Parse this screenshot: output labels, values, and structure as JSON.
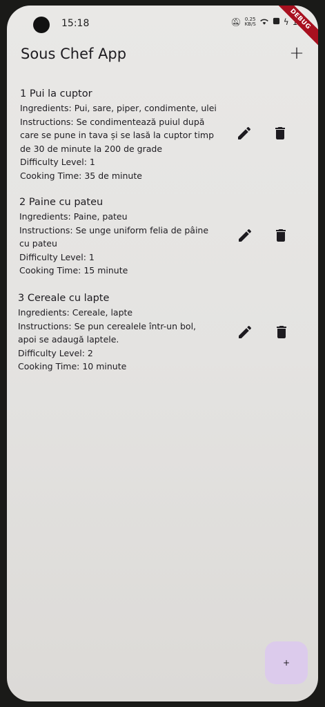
{
  "status_bar": {
    "time": "15:18",
    "net_speed": "0.25\nKB/S",
    "battery": "14",
    "debug_label": "DEBUG"
  },
  "app_bar": {
    "title": "Sous Chef App",
    "add_label": "+"
  },
  "recipes": [
    {
      "title": "1 Pui la cuptor",
      "ingredients": "Ingredients: Pui, sare, piper, condimente, ulei",
      "instructions_lines": [
        "Instructions: Se condimentează puiul după",
        "care se pune in tava și se lasă la cuptor timp",
        "de 30 de minute la 200 de grade"
      ],
      "difficulty": "Difficulty Level: 1",
      "cooking_time": "Cooking Time: 35 de minute"
    },
    {
      "title": "2 Paine cu pateu",
      "ingredients": "Ingredients: Paine, pateu",
      "instructions_lines": [
        "Instructions: Se unge uniform felia de pâine",
        "cu pateu"
      ],
      "difficulty": "Difficulty Level: 1",
      "cooking_time": "Cooking Time: 15 minute"
    },
    {
      "title": "3 Cereale cu lapte",
      "ingredients": "Ingredients: Cereale, lapte",
      "instructions_lines": [
        "Instructions: Se pun cerealele într-un bol,",
        "apoi se adaugă laptele."
      ],
      "difficulty": "Difficulty Level: 2",
      "cooking_time": "Cooking Time: 10 minute"
    }
  ],
  "fab": {
    "label": "+"
  },
  "colors": {
    "background": "#e6e5e3",
    "text": "#1d1b20",
    "fab": "#dccbec",
    "debug_banner": "#a8101f"
  }
}
